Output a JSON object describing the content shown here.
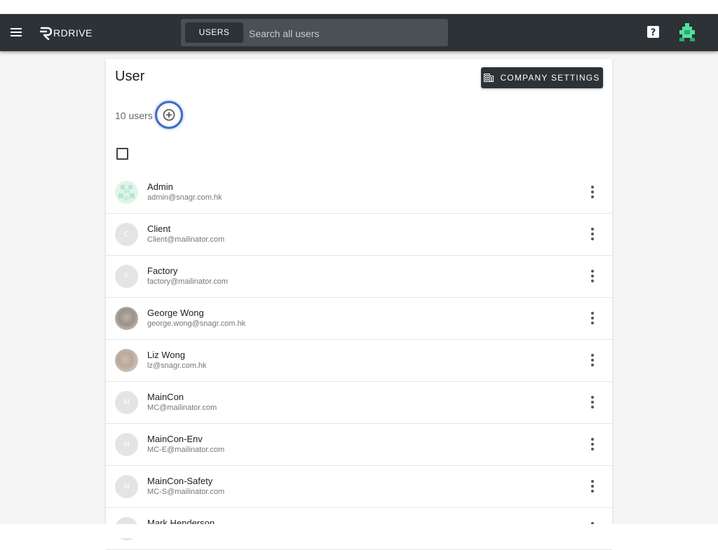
{
  "app": {
    "logo_text": "RDRIVE"
  },
  "search": {
    "scope_tab": "USERS",
    "placeholder": "Search all users",
    "value": ""
  },
  "page": {
    "title": "User",
    "company_settings_label": "COMPANY SETTINGS",
    "user_count": "10 users"
  },
  "users": [
    {
      "name": "Admin",
      "email": "admin@snagr.com.hk",
      "initial": ""
    },
    {
      "name": "Client",
      "email": "Client@mailinator.com",
      "initial": "C"
    },
    {
      "name": "Factory",
      "email": "factory@mailinator.com",
      "initial": "F"
    },
    {
      "name": "George Wong",
      "email": "george.wong@snagr.com.hk",
      "initial": ""
    },
    {
      "name": "Liz Wong",
      "email": "lz@snagr.com.hk",
      "initial": ""
    },
    {
      "name": "MainCon",
      "email": "MC@mailinator.com",
      "initial": "M"
    },
    {
      "name": "MainCon-Env",
      "email": "MC-E@mailinator.com",
      "initial": "M"
    },
    {
      "name": "MainCon-Safety",
      "email": "MC-S@mailinator.com",
      "initial": "M"
    },
    {
      "name": "Mark Henderson",
      "email": "",
      "initial": "M"
    }
  ],
  "icons": {
    "menu": "menu-icon",
    "help": "help-icon",
    "company": "building-icon",
    "add": "add-circle-icon",
    "more": "more-vert-icon"
  },
  "colors": {
    "appbar": "#2c3235",
    "focus_ring": "#3d6cc4",
    "avatar_accent": "#4fe3a0"
  }
}
